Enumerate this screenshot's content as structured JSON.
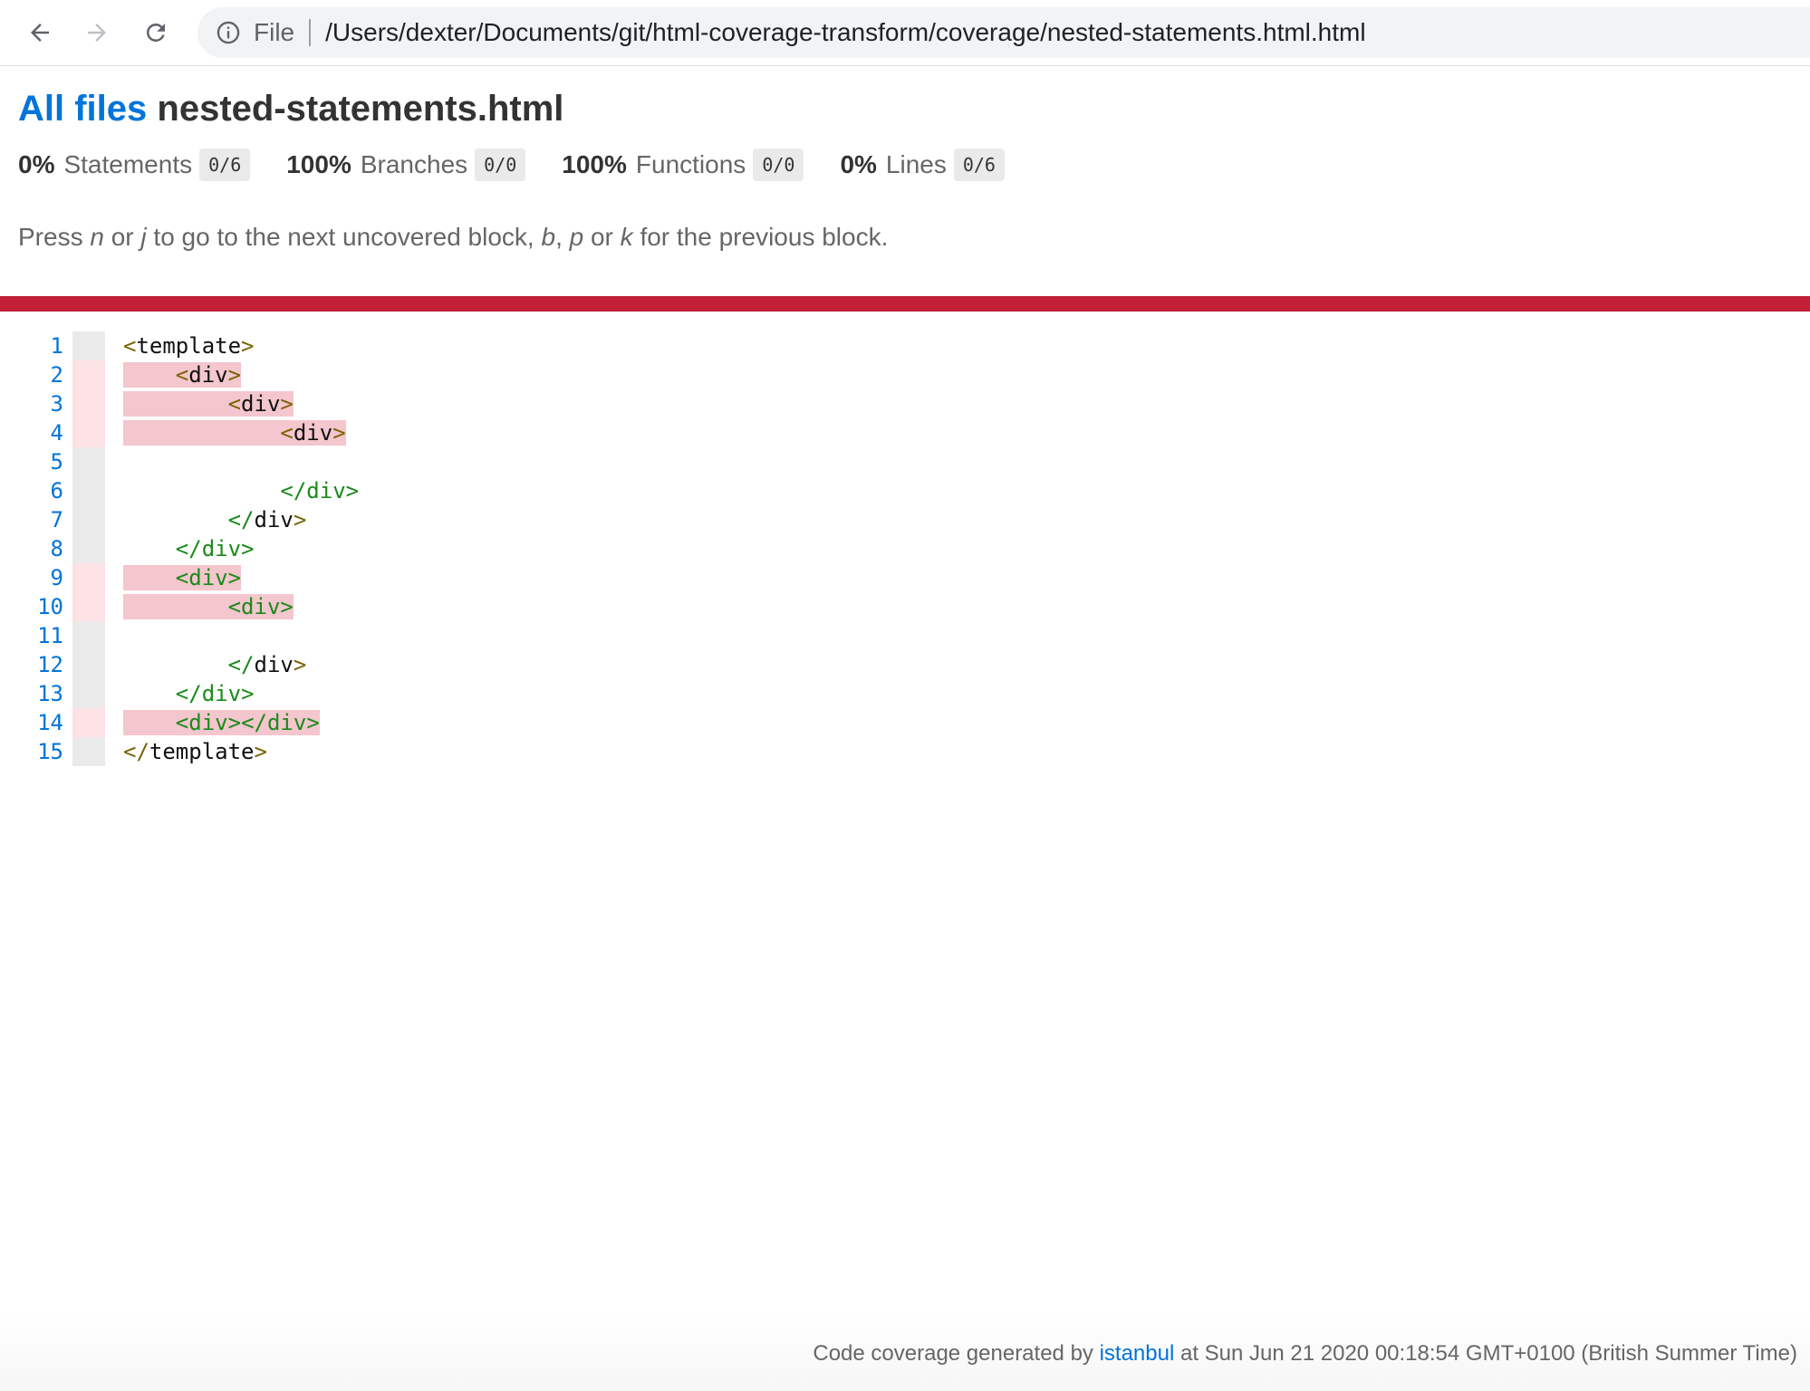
{
  "browser": {
    "scheme_label": "File",
    "url": "/Users/dexter/Documents/git/html-coverage-transform/coverage/nested-statements.html.html"
  },
  "header": {
    "all_files_link": "All files",
    "file_name": "nested-statements.html"
  },
  "summary": [
    {
      "pct": "0%",
      "name": "Statements",
      "fraction": "0/6"
    },
    {
      "pct": "100%",
      "name": "Branches",
      "fraction": "0/0"
    },
    {
      "pct": "100%",
      "name": "Functions",
      "fraction": "0/0"
    },
    {
      "pct": "0%",
      "name": "Lines",
      "fraction": "0/6"
    }
  ],
  "hint": {
    "press": "Press ",
    "key_n": "n",
    "or1": " or ",
    "key_j": "j",
    "next_text": " to go to the next uncovered block, ",
    "key_b": "b",
    "comma": ", ",
    "key_p": "p",
    "or2": " or ",
    "key_k": "k",
    "prev_text": " for the previous block."
  },
  "code_lines": [
    {
      "n": "1",
      "indent": "",
      "text": "<template>",
      "kind": "open-template",
      "uncovered": false
    },
    {
      "n": "2",
      "indent": "    ",
      "text": "<div>",
      "kind": "open",
      "uncovered": true
    },
    {
      "n": "3",
      "indent": "        ",
      "text": "<div>",
      "kind": "open",
      "uncovered": true
    },
    {
      "n": "4",
      "indent": "            ",
      "text": "<div>",
      "kind": "open",
      "uncovered": true
    },
    {
      "n": "5",
      "indent": "",
      "text": "",
      "kind": "blank",
      "uncovered": false
    },
    {
      "n": "6",
      "indent": "            ",
      "text": "</div>",
      "kind": "close",
      "uncovered": false
    },
    {
      "n": "7",
      "indent": "        ",
      "text": "</div>",
      "kind": "close-plain",
      "uncovered": false
    },
    {
      "n": "8",
      "indent": "    ",
      "text": "</div>",
      "kind": "close",
      "uncovered": false
    },
    {
      "n": "9",
      "indent": "    ",
      "text": "<div>",
      "kind": "open-green",
      "uncovered": true
    },
    {
      "n": "10",
      "indent": "        ",
      "text": "<div>",
      "kind": "open-green",
      "uncovered": true
    },
    {
      "n": "11",
      "indent": "",
      "text": "",
      "kind": "blank",
      "uncovered": false
    },
    {
      "n": "12",
      "indent": "        ",
      "text": "</div>",
      "kind": "close-plain",
      "uncovered": false
    },
    {
      "n": "13",
      "indent": "    ",
      "text": "</div>",
      "kind": "close",
      "uncovered": false
    },
    {
      "n": "14",
      "indent": "    ",
      "text": "<div></div>",
      "kind": "pair",
      "uncovered": true
    },
    {
      "n": "15",
      "indent": "",
      "text": "</template>",
      "kind": "close-template",
      "uncovered": false
    }
  ],
  "footer": {
    "prefix": "Code coverage generated by ",
    "link": "istanbul",
    "suffix": " at Sun Jun 21 2020 00:18:54 GMT+0100 (British Summer Time)"
  },
  "colors": {
    "link_blue": "#0074d9",
    "status_red": "#c21f39",
    "uncovered_bg": "#f4c6cd"
  },
  "icons": {
    "back": "arrow-left-icon",
    "forward": "arrow-right-icon",
    "reload": "reload-icon",
    "info": "info-icon"
  }
}
